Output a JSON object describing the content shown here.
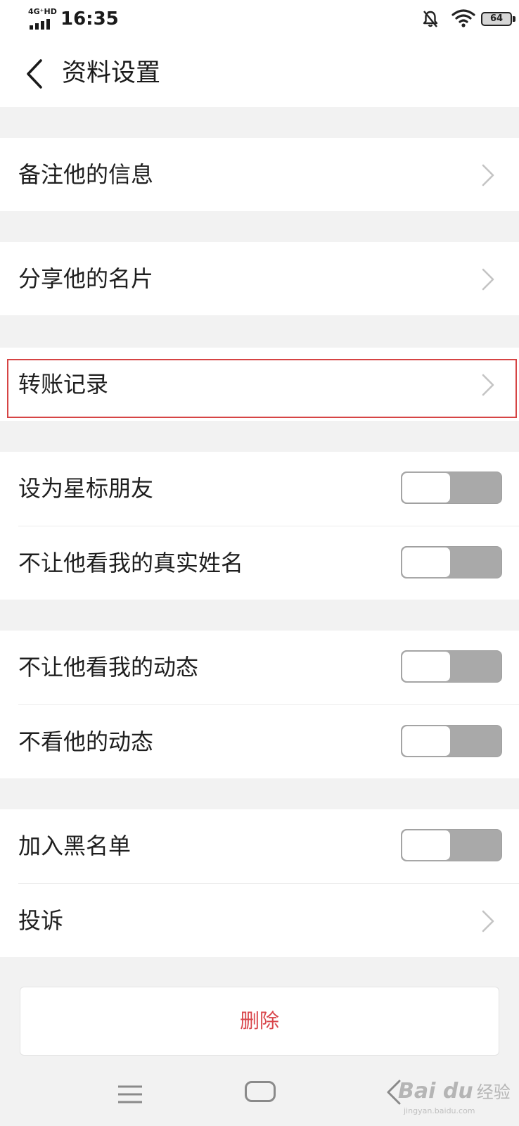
{
  "status_bar": {
    "network": "4G⁺HD",
    "time": "16:35",
    "battery": "64"
  },
  "header": {
    "title": "资料设置"
  },
  "rows": {
    "remark": "备注他的信息",
    "share_card": "分享他的名片",
    "transfer_records": "转账记录",
    "star_friend": "设为星标朋友",
    "hide_real_name": "不让他看我的真实姓名",
    "hide_my_moments": "不让他看我的动态",
    "hide_his_moments": "不看他的动态",
    "blacklist": "加入黑名单",
    "complain": "投诉"
  },
  "toggles": {
    "star_friend": false,
    "hide_real_name": false,
    "hide_my_moments": false,
    "hide_his_moments": false,
    "blacklist": false
  },
  "delete_button": "删除",
  "watermark": {
    "logo": "Bai du",
    "text": "经验",
    "url": "jingyan.baidu.com"
  },
  "colors": {
    "delete_text": "#d9464b",
    "highlight_border": "#d64444",
    "toggle_off": "#a9a9a9"
  }
}
